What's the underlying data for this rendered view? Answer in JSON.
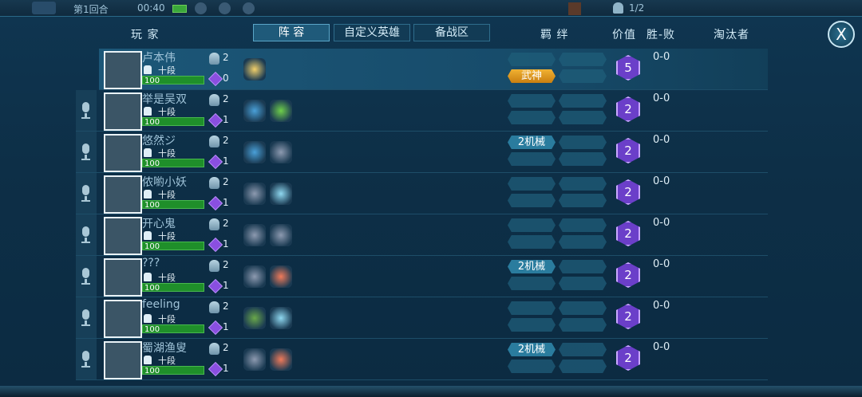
{
  "topbar": {
    "round": "第1回合",
    "time": "00:40",
    "player_count": "1/2"
  },
  "close_label": "X",
  "headers": {
    "player": "玩 家",
    "value": "价值",
    "winloss": "胜-败",
    "eliminator": "淘汰者",
    "bonds": "羁 绊"
  },
  "tabs": [
    {
      "label": "阵 容",
      "active": true
    },
    {
      "label": "自定义英雄",
      "active": false
    },
    {
      "label": "备战区",
      "active": false
    }
  ],
  "players": [
    {
      "name": "卢本伟",
      "rank": "十段",
      "hp": "100",
      "helm": "2",
      "gems": "0",
      "value": "5",
      "record": "0-0",
      "bonds": [
        "",
        "武神"
      ],
      "units": [
        "#f2d06a"
      ]
    },
    {
      "name": "举是吴双",
      "rank": "十段",
      "hp": "100",
      "helm": "2",
      "gems": "1",
      "value": "2",
      "record": "0-0",
      "bonds": [
        "",
        ""
      ],
      "units": [
        "#4aa0d8",
        "#6fcf4a"
      ]
    },
    {
      "name": "悠然ジ",
      "rank": "十段",
      "hp": "100",
      "helm": "2",
      "gems": "1",
      "value": "2",
      "record": "0-0",
      "bonds": [
        "2机械",
        ""
      ],
      "units": [
        "#4aa0d8",
        "#8d9ab0"
      ]
    },
    {
      "name": "侬喲小妖",
      "rank": "十段",
      "hp": "100",
      "helm": "2",
      "gems": "1",
      "value": "2",
      "record": "0-0",
      "bonds": [
        "",
        ""
      ],
      "units": [
        "#8d9ab0",
        "#8fd8f0"
      ]
    },
    {
      "name": "开心鬼",
      "rank": "十段",
      "hp": "100",
      "helm": "2",
      "gems": "1",
      "value": "2",
      "record": "0-0",
      "bonds": [
        "",
        ""
      ],
      "units": [
        "#8d9ab0",
        "#8d9ab0"
      ]
    },
    {
      "name": "???",
      "rank": "十段",
      "hp": "100",
      "helm": "2",
      "gems": "1",
      "value": "2",
      "record": "0-0",
      "bonds": [
        "2机械",
        ""
      ],
      "units": [
        "#8d9ab0",
        "#f07a5a"
      ]
    },
    {
      "name": "feeling",
      "rank": "十段",
      "hp": "100",
      "helm": "2",
      "gems": "1",
      "value": "2",
      "record": "0-0",
      "bonds": [
        "",
        ""
      ],
      "units": [
        "#6aa84a",
        "#8fd8f0"
      ]
    },
    {
      "name": "蜀湖渔叟",
      "rank": "十段",
      "hp": "100",
      "helm": "2",
      "gems": "1",
      "value": "2",
      "record": "0-0",
      "bonds": [
        "2机械",
        ""
      ],
      "units": [
        "#8d9ab0",
        "#f07a5a"
      ]
    }
  ]
}
